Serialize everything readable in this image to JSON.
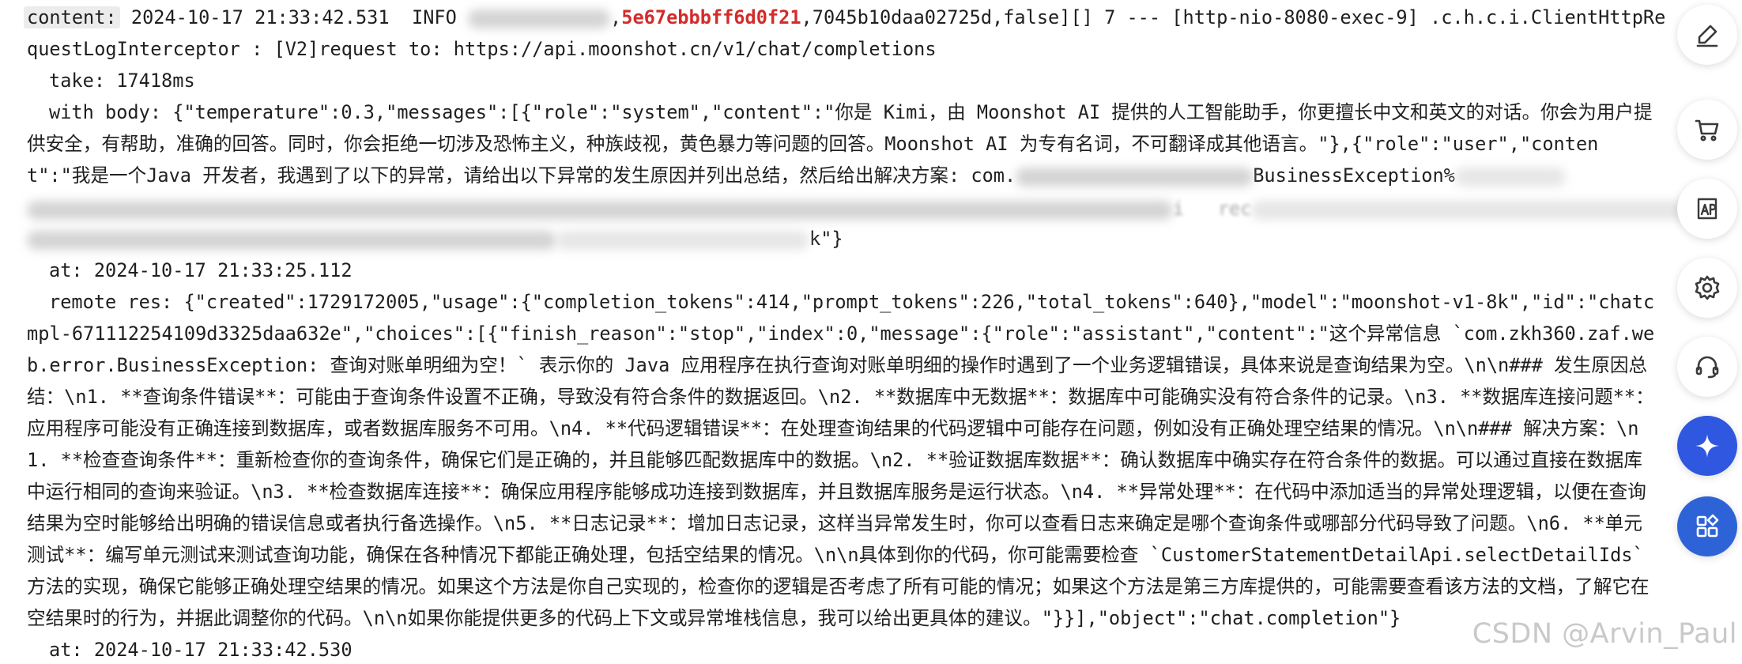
{
  "log": {
    "l1": {
      "key": "content:",
      "timestamp": "2024-10-17 21:33:42.531",
      "level": "INFO",
      "trace_id": "5e67ebbbff6d0f21",
      "rest": ",7045b10daa02725d,false][] 7 --- [http-nio-8080-exec-9] .c.h.c.i.ClientHttpRe"
    },
    "l2": "questLogInterceptor : [V2]request to: https://api.moonshot.cn/v1/chat/completions",
    "l3": "take: 17418ms",
    "l4": "with body: {\"temperature\":0.3,\"messages\":[{\"role\":\"system\",\"content\":\"你是 Kimi，由 Moonshot AI 提供的人工智能助手，你更擅长中文和英文的对话。你会为用户提",
    "l5": "供安全，有帮助，准确的回答。同时，你会拒绝一切涉及恐怖主义，种族歧视，黄色暴力等问题的回答。Moonshot AI 为专有名词，不可翻译成其他语言。\"},{\"role\":\"user\",\"conten",
    "l6": {
      "start": "t\":\"我是一个Java 开发者，我遇到了以下的异常，请给出以下异常的发生原因并列出总结，然后给出解决方案: com.",
      "end": "BusinessException%"
    },
    "l7": {
      "ghost": "i   rec"
    },
    "l8": {
      "end": "k\"}"
    },
    "l9": "at: 2024-10-17 21:33:25.112",
    "l10": "remote res: {\"created\":1729172005,\"usage\":{\"completion_tokens\":414,\"prompt_tokens\":226,\"total_tokens\":640},\"model\":\"moonshot-v1-8k\",\"id\":\"chatc",
    "l11": "mpl-671112254109d3325daa632e\",\"choices\":[{\"finish_reason\":\"stop\",\"index\":0,\"message\":{\"role\":\"assistant\",\"content\":\"这个异常信息 `com.zkh360.zaf.we",
    "l12": "b.error.BusinessException: 查询对账单明细为空！` 表示你的 Java 应用程序在执行查询对账单明细的操作时遇到了一个业务逻辑错误，具体来说是查询结果为空。\\n\\n### 发生原因总",
    "l13": "结：\\n1. **查询条件错误**：可能由于查询条件设置不正确，导致没有符合条件的数据返回。\\n2. **数据库中无数据**：数据库中可能确实没有符合条件的记录。\\n3. **数据库连接问题**：",
    "l14": "应用程序可能没有正确连接到数据库，或者数据库服务不可用。\\n4. **代码逻辑错误**：在处理查询结果的代码逻辑中可能存在问题，例如没有正确处理空结果的情况。\\n\\n### 解决方案：\\n",
    "l15": "1. **检查查询条件**：重新检查你的查询条件，确保它们是正确的，并且能够匹配数据库中的数据。\\n2. **验证数据库数据**：确认数据库中确实存在符合条件的数据。可以通过直接在数据库",
    "l16": "中运行相同的查询来验证。\\n3. **检查数据库连接**：确保应用程序能够成功连接到数据库，并且数据库服务是运行状态。\\n4. **异常处理**：在代码中添加适当的异常处理逻辑，以便在查询",
    "l17": "结果为空时能够给出明确的错误信息或者执行备选操作。\\n5. **日志记录**：增加日志记录，这样当异常发生时，你可以查看日志来确定是哪个查询条件或哪部分代码导致了问题。\\n6. **单元",
    "l18": "测试**：编写单元测试来测试查询功能，确保在各种情况下都能正确处理，包括空结果的情况。\\n\\n具体到你的代码，你可能需要检查 `CustomerStatementDetailApi.selectDetailIds`",
    "l19": "方法的实现，确保它能够正确处理空结果的情况。如果这个方法是你自己实现的，检查你的逻辑是否考虑了所有可能的情况；如果这个方法是第三方库提供的，可能需要查看该方法的文档，了解它在",
    "l20": "空结果时的行为，并据此调整你的代码。\\n\\n如果你能提供更多的代码上下文或异常堆栈信息，我可以给出更具体的建议。\"}}],\"object\":\"chat.completion\"}",
    "l21": "at: 2024-10-17 21:33:42.530"
  },
  "toolbar": {
    "items": [
      {
        "icon": "edit-icon"
      },
      {
        "icon": "cart-icon"
      },
      {
        "icon": "app-icon"
      },
      {
        "icon": "settings-icon"
      },
      {
        "icon": "headset-icon"
      },
      {
        "icon": "assistant-logo-icon"
      },
      {
        "icon": "apps-grid-icon"
      }
    ],
    "brand_color": "#2f57e0"
  },
  "watermark": "CSDN @Arvin_Paul",
  "colors": {
    "trace_id": "#d42b2b",
    "text": "#1f1f1f",
    "key_bg": "#ececec"
  }
}
